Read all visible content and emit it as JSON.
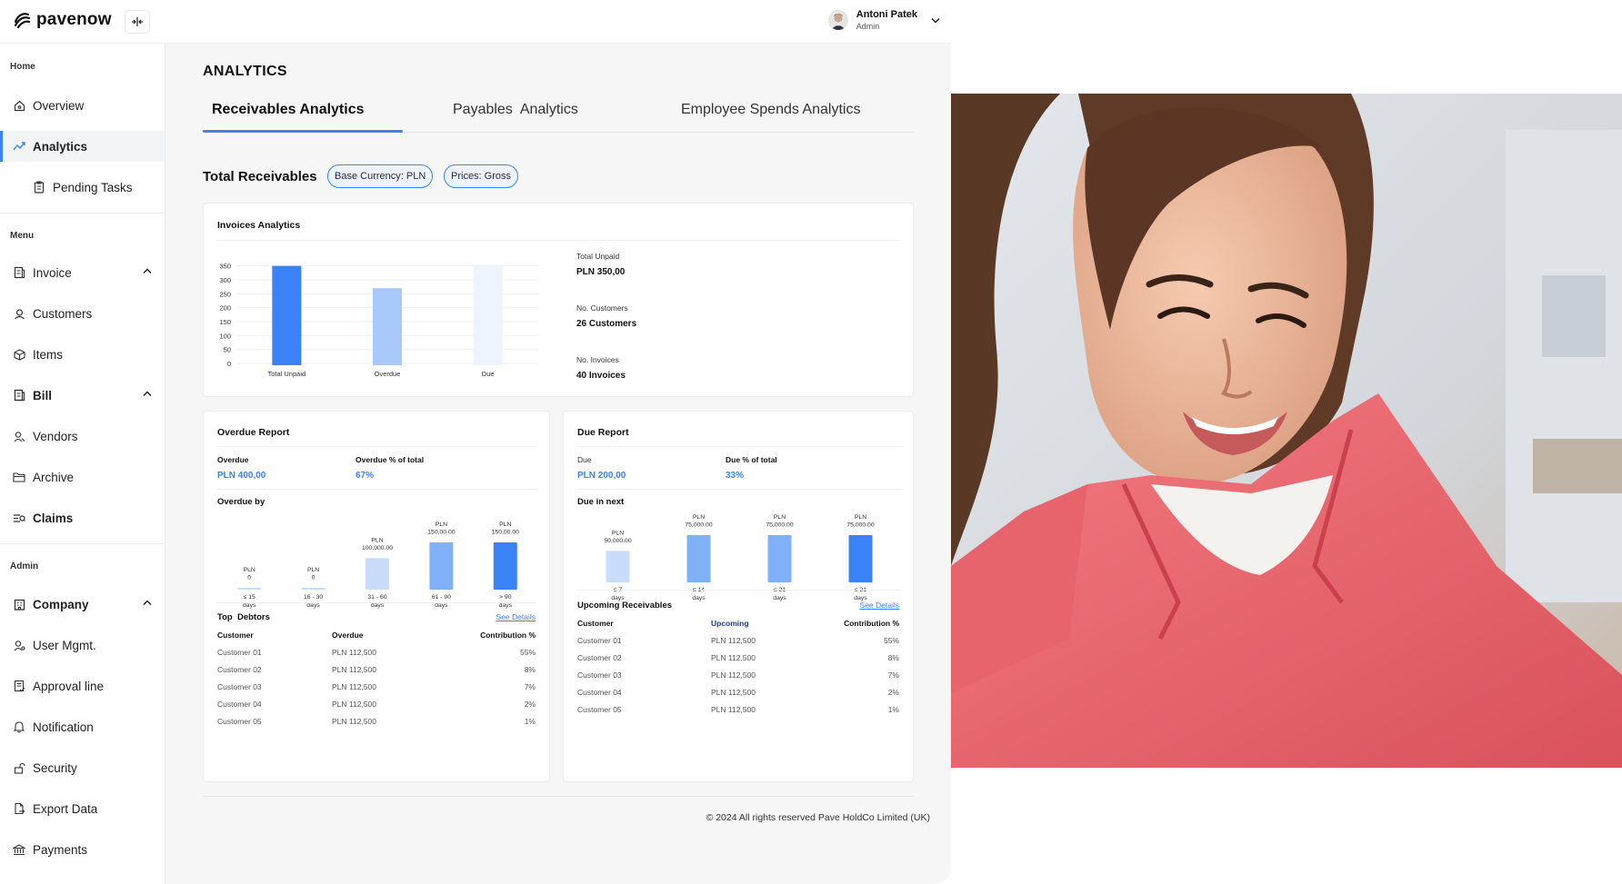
{
  "brand": {
    "name": "pavenow"
  },
  "user": {
    "name": "Antoni Patek",
    "role": "Admin"
  },
  "sidebar": {
    "sections": {
      "home": "Home",
      "menu": "Menu",
      "admin": "Admin"
    },
    "items": [
      {
        "label": "Overview",
        "icon": "home-icon"
      },
      {
        "label": "Analytics",
        "icon": "trend-icon"
      },
      {
        "label": "Pending Tasks",
        "icon": "clipboard-icon"
      },
      {
        "label": "Invoice",
        "icon": "invoice-icon"
      },
      {
        "label": "Customers",
        "icon": "customers-icon"
      },
      {
        "label": "Items",
        "icon": "box-icon"
      },
      {
        "label": "Bill",
        "icon": "bill-icon"
      },
      {
        "label": "Vendors",
        "icon": "vendors-icon"
      },
      {
        "label": "Archive",
        "icon": "folder-icon"
      },
      {
        "label": "Claims",
        "icon": "claims-icon"
      },
      {
        "label": "Company",
        "icon": "company-icon"
      },
      {
        "label": "User Mgmt.",
        "icon": "user-icon"
      },
      {
        "label": "Approval line",
        "icon": "approval-icon"
      },
      {
        "label": "Notification",
        "icon": "bell-icon"
      },
      {
        "label": "Security",
        "icon": "lock-icon"
      },
      {
        "label": "Export Data",
        "icon": "export-icon"
      },
      {
        "label": "Payments",
        "icon": "bank-icon"
      }
    ]
  },
  "main": {
    "title": "ANALYTICS",
    "tabs": [
      "Receivables Analytics",
      "Payables  Analytics",
      "Employee Spends Analytics"
    ],
    "section_title": "Total Receivables",
    "pills": [
      "Base Currency: PLN",
      "Prices: Gross"
    ],
    "invoices": {
      "title": "Invoices Analytics",
      "stats": [
        {
          "label": "Total Unpaid",
          "value": "PLN 350,00"
        },
        {
          "label": "No. Customers",
          "value": "26 Customers"
        },
        {
          "label": "No. Invoices",
          "value": "40 Invoices"
        }
      ]
    },
    "overdue": {
      "title": "Overdue Report",
      "overdue_label": "Overdue",
      "overdue_value": "PLN 400,00",
      "pct_label": "Overdue % of total",
      "pct_value": "67%",
      "by_title": "Overdue by",
      "debtors_title": "Top  Debtors",
      "see_details": "See Details",
      "headers": [
        "Customer",
        "Overdue",
        "Contribution %"
      ],
      "rows": [
        [
          "Customer 01",
          "PLN 112,500",
          "55%"
        ],
        [
          "Customer 02",
          "PLN 112,500",
          "8%"
        ],
        [
          "Customer 03",
          "PLN 112,500",
          "7%"
        ],
        [
          "Customer 04",
          "PLN 112,500",
          "2%"
        ],
        [
          "Customer 05",
          "PLN 112,500",
          "1%"
        ]
      ]
    },
    "due": {
      "title": "Due Report",
      "due_label": "Due",
      "due_value": "PLN 200,00",
      "pct_label": "Due % of total",
      "pct_value": "33%",
      "next_title": "Due in next",
      "upcoming_title": "Upcoming Receivables",
      "see_details": "See Details",
      "headers": [
        "Customer",
        "Upcoming",
        "Contribution %"
      ],
      "rows": [
        [
          "Customer 01",
          "PLN 112,500",
          "55%"
        ],
        [
          "Customer 02",
          "PLN 112,500",
          "8%"
        ],
        [
          "Customer 03",
          "PLN 112,500",
          "7%"
        ],
        [
          "Customer 04",
          "PLN 112,500",
          "2%"
        ],
        [
          "Customer 05",
          "PLN 112,500",
          "1%"
        ]
      ]
    },
    "footer": "© 2024 All rights reserved Pave HoldCo Limited (UK)"
  },
  "chart_data": [
    {
      "type": "bar",
      "categories": [
        "Total Unpaid",
        "Overdue",
        "Due"
      ],
      "values": [
        350,
        270,
        355
      ],
      "yticks": [
        0,
        50,
        100,
        150,
        200,
        250,
        300,
        350
      ],
      "ylim": [
        0,
        360
      ],
      "colors": [
        "#3b82f6",
        "#a9c9fb",
        "#eef4fe"
      ]
    },
    {
      "type": "bar",
      "categories": [
        "≤ 15\ndays",
        "16 - 30\ndays",
        "31 - 60\ndays",
        "61 - 90\ndays",
        "> 90\ndays"
      ],
      "values": [
        0,
        0,
        100000,
        150000,
        150000
      ],
      "data_labels": [
        "PLN\n0",
        "PLN\n0",
        "PLN\n100,000.00",
        "PLN\n150,00.00",
        "PLN\n150,00.00"
      ],
      "colors": [
        "#c9dcfc",
        "#c9dcfc",
        "#c9dcfc",
        "#7fb0f8",
        "#3b82f6"
      ]
    },
    {
      "type": "bar",
      "categories": [
        "≤ 7\ndays",
        "≤ 14\ndays",
        "≤ 21\ndays",
        "≤ 21\ndays"
      ],
      "values": [
        50000,
        75000,
        75000,
        75000
      ],
      "data_labels": [
        "PLN\n50,000.00",
        "PLN\n75,000.00",
        "PLN\n75,000.00",
        "PLN\n75,000.00"
      ],
      "colors": [
        "#c9dcfc",
        "#7fb0f8",
        "#7fb0f8",
        "#3b82f6"
      ]
    }
  ]
}
